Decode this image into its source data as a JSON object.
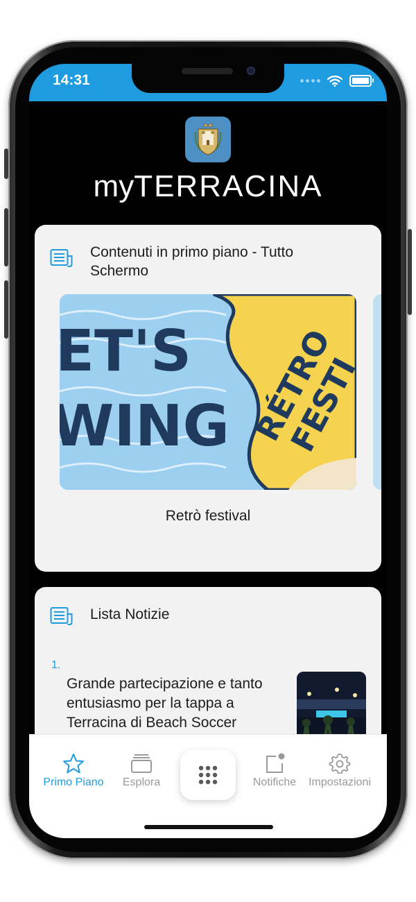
{
  "status_bar": {
    "time": "14:31"
  },
  "header": {
    "brand_light": "MY",
    "brand_bold": "TERRACINA",
    "crest_icon": "city-crest-icon"
  },
  "featured": {
    "title": "Contenuti in primo piano - Tutto Schermo",
    "slide": {
      "caption": "Retrò festival",
      "poster_text_left_1": "ET'S",
      "poster_text_left_2": "WING",
      "poster_text_right_1": "RÉTRO",
      "poster_text_right_2": "FESTI"
    }
  },
  "news": {
    "title": "Lista Notizie",
    "items": [
      {
        "number": "1.",
        "title": "Grande partecipazione e tanto entusiasmo per la tappa a Terracina di Beach Soccer"
      }
    ]
  },
  "tabbar": {
    "tabs": [
      {
        "label": "Primo Piano",
        "icon": "star-icon",
        "active": true
      },
      {
        "label": "Esplora",
        "icon": "cards-stack-icon",
        "active": false
      },
      {
        "label": "Notifiche",
        "icon": "notification-icon",
        "active": false
      },
      {
        "label": "Impostazioni",
        "icon": "gear-icon",
        "active": false
      }
    ],
    "center_icon": "grid-menu-icon"
  },
  "colors": {
    "accent": "#1f9be0",
    "card_bg": "#f2f2f2",
    "screen_bg": "#000000"
  }
}
